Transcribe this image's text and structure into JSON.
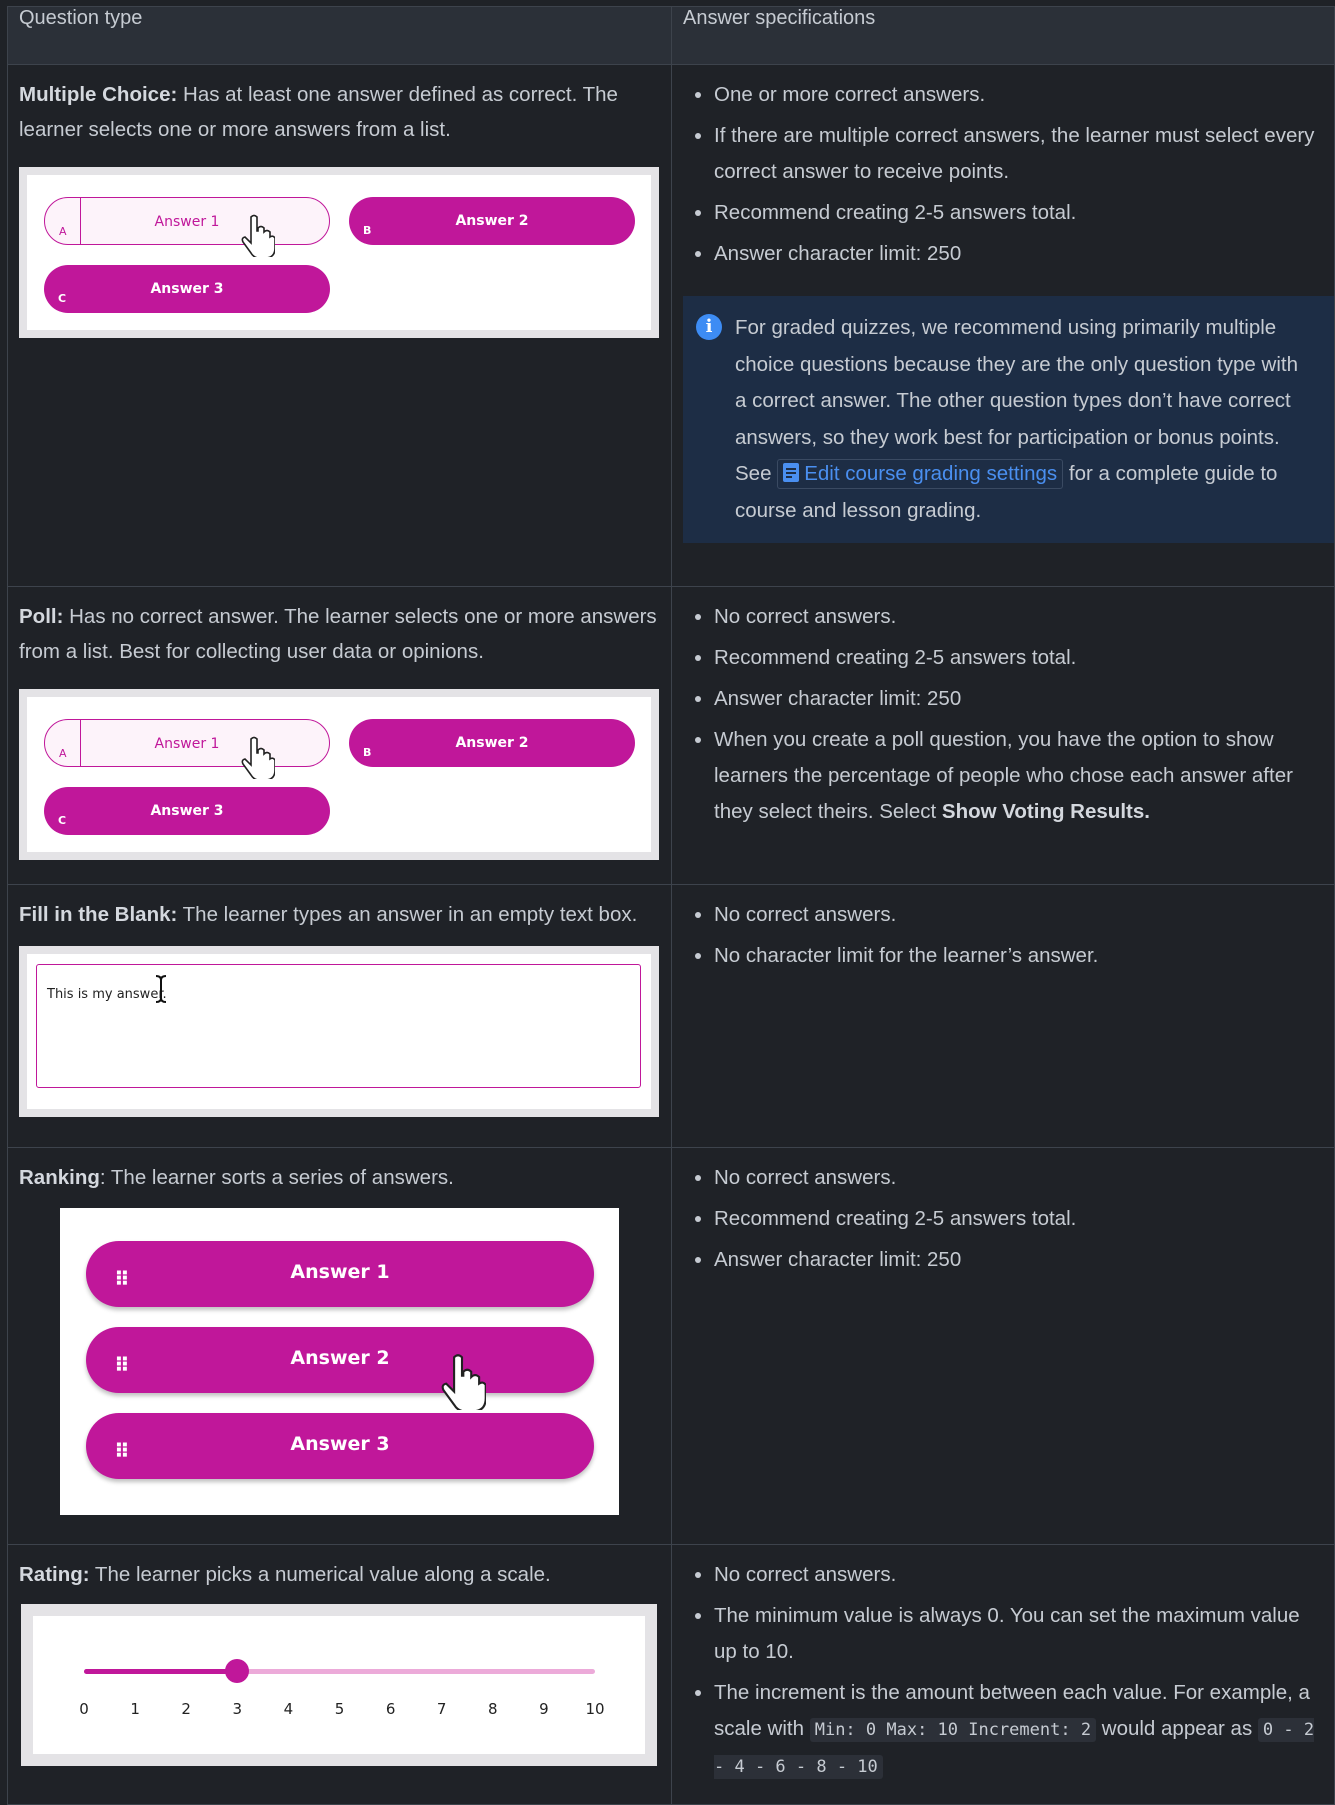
{
  "table": {
    "headers": [
      "Question type",
      "Answer specifications"
    ],
    "rows": [
      {
        "title": "Multiple Choice:",
        "desc": " Has at least one answer defined as correct. The learner selects one or more answers from a list.",
        "specs": [
          "One or more correct answers.",
          "If there are multiple correct answers, the learner must select every correct answer to receive points.",
          "Recommend creating 2-5 answers total.",
          "Answer character limit: 250"
        ],
        "notice": {
          "text": "For graded quizzes, we recommend using primarily multiple choice questions because they are the only question type with a correct answer. The other question types don’t have correct answers, so they work best for participation or bonus points.",
          "see": "See",
          "link": "Edit course grading settings",
          "after": "for a complete guide to course and lesson grading."
        }
      },
      {
        "title": "Poll:",
        "desc": " Has no correct answer. The learner selects one or more answers from a list. Best for collecting user data or opinions.",
        "specs": [
          "No correct answers.",
          "Recommend creating 2-5 answers total.",
          "Answer character limit: 250"
        ],
        "spec_last": "When you create a poll question, you have the option to show learners the percentage of people who chose each answer after they select theirs. Select ",
        "spec_last_bold": "Show Voting Results."
      },
      {
        "title": "Fill in the Blank:",
        "desc": " The learner types an answer in an empty text box.",
        "specs": [
          "No correct answers.",
          "No character limit for the learner’s answer."
        ],
        "answer_text": "This is my answer."
      },
      {
        "title": "Ranking",
        "desc": ": The learner sorts a series of answers.",
        "specs": [
          "No correct answers.",
          "Recommend creating 2-5 answers total.",
          "Answer character limit: 250"
        ]
      },
      {
        "title": "Rating:",
        "desc": " The learner picks a numerical value along a scale.",
        "specs": [
          "No correct answers.",
          "The minimum value is always 0. You can set the maximum value up to 10."
        ],
        "spec_inc_before": "The increment is the amount between each value. For example, a scale with ",
        "spec_inc_code1": "Min: 0 Max: 10 Increment: 2",
        "spec_inc_mid": " would appear as ",
        "spec_inc_code2": "0 - 2 - 4 - 6 - 8 - 10"
      }
    ]
  },
  "choices": {
    "letters": [
      "A",
      "B",
      "C"
    ],
    "labels": [
      "Answer 1",
      "Answer 2",
      "Answer 3"
    ],
    "selected_index": 0
  },
  "rating_widget": {
    "ticks": [
      "0",
      "1",
      "2",
      "3",
      "4",
      "5",
      "6",
      "7",
      "8",
      "9",
      "10"
    ],
    "value": 3,
    "max": 10
  },
  "colors": {
    "accent": "#c0179a",
    "page_bg": "#1f2227",
    "header_bg": "#2b3038",
    "notice_bg": "#1d2d45",
    "link": "#4a8ff0"
  },
  "icons": [
    "info-icon",
    "document-icon",
    "hand-cursor-icon",
    "text-cursor-icon",
    "drag-handle-icon"
  ]
}
